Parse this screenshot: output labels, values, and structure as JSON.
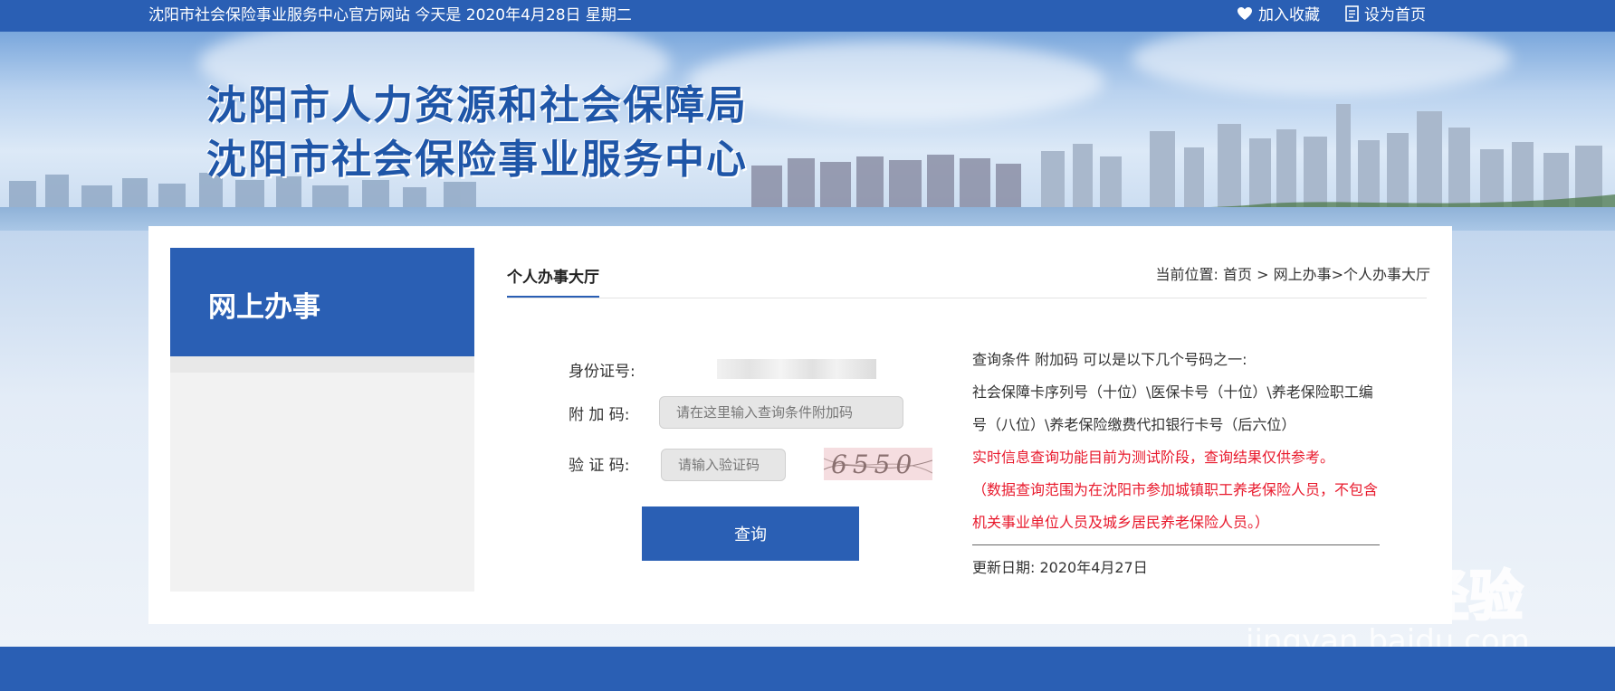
{
  "topbar": {
    "site_info": "沈阳市社会保险事业服务中心官方网站 今天是 2020年4月28日 星期二",
    "bookmark_label": "加入收藏",
    "homepage_label": "设为首页"
  },
  "banner": {
    "title_line1": "沈阳市人力资源和社会保障局",
    "title_line2": "沈阳市社会保险事业服务中心"
  },
  "sidebar": {
    "title": "网上办事"
  },
  "content": {
    "tab_label": "个人办事大厅",
    "breadcrumb": {
      "prefix": "当前位置:",
      "home": "首页",
      "sep": ">",
      "section": "网上办事",
      "sep2": ">",
      "current": "个人办事大厅"
    }
  },
  "form": {
    "id_label": "身份证号:",
    "extra_label": "附 加 码:",
    "extra_placeholder": "请在这里输入查询条件附加码",
    "captcha_label": "验 证 码:",
    "captcha_placeholder": "请输入验证码",
    "captcha_text": "6550",
    "submit_label": "查询"
  },
  "info": {
    "line1": "查询条件 附加码 可以是以下几个号码之一:",
    "line2": "社会保障卡序列号（十位）\\医保卡号（十位）\\养老保险职工编号（八位）\\养老保险缴费代扣银行卡号（后六位）",
    "notice": "实时信息查询功能目前为测试阶段，查询结果仅供参考。",
    "scope": "（数据查询范围为在沈阳市参加城镇职工养老保险人员，不包含机关事业单位人员及城乡居民养老保险人员。）",
    "update": "更新日期: 2020年4月27日"
  },
  "watermark": {
    "brand": "Baidu经验",
    "url": "jingyan.baidu.com"
  },
  "colors": {
    "primary": "#2a5fb4",
    "notice": "#e8192c"
  }
}
